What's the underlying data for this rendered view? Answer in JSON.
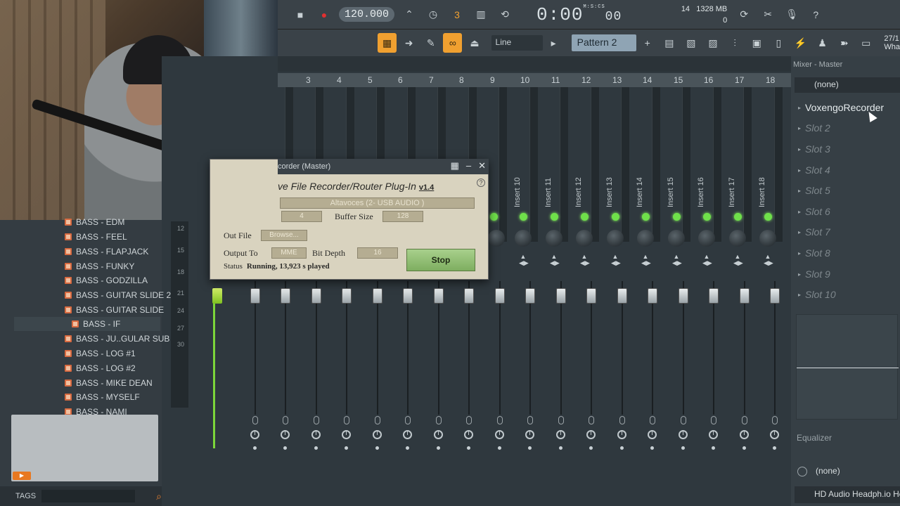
{
  "toolbar": {
    "tempo": "120.000",
    "time": "0:00",
    "time_frac": "00",
    "time_unit": "M:S:CS",
    "cpu_count": "14",
    "memory": "1328 MB",
    "poly": "0",
    "snap": "Line",
    "pattern": "Pattern 2",
    "what": "27/1",
    "what2": "Wha"
  },
  "mixer": {
    "title": "Mixer - Master",
    "numbers": [
      "3",
      "4",
      "5",
      "6",
      "7",
      "8",
      "9",
      "10",
      "11",
      "12",
      "13",
      "14",
      "15",
      "16",
      "17",
      "18"
    ],
    "inserts": [
      "Insert 10",
      "Insert 11",
      "Insert 12",
      "Insert 13",
      "Insert 14",
      "Insert 15",
      "Insert 16",
      "Insert 17",
      "Insert 18"
    ],
    "db_labels": [
      "12",
      "15",
      "18",
      "21",
      "24",
      "27",
      "30"
    ]
  },
  "browser": {
    "items": [
      "BASS - EDM",
      "BASS - FEEL",
      "BASS - FLAPJACK",
      "BASS - FUNKY",
      "BASS - GODZILLA",
      "BASS - GUITAR SLIDE 2",
      "BASS - GUITAR SLIDE",
      "BASS - IF",
      "BASS - JU..GULAR SUB",
      "BASS - LOG #1",
      "BASS - LOG #2",
      "BASS - MIKE DEAN",
      "BASS - MYSELF",
      "BASS - NAMI"
    ],
    "tags_label": "TAGS"
  },
  "right_panel": {
    "input": "(none)",
    "slots": [
      "VoxengoRecorder",
      "Slot 2",
      "Slot 3",
      "Slot 4",
      "Slot 5",
      "Slot 6",
      "Slot 7",
      "Slot 8",
      "Slot 9",
      "Slot 10"
    ],
    "eq_label": "Equalizer",
    "output": "(none)",
    "device": "HD Audio Headph.io He"
  },
  "plugin": {
    "title": "corder (Master)",
    "heading": "ve File Recorder/Router Plug-In",
    "version": "v1.4",
    "help": "?",
    "device": "Altavoces (2- USB AUDIO )",
    "channels": "4",
    "buffer_label": "Buffer Size",
    "buffer_value": "128",
    "out_file_label": "Out File",
    "browse": "Browse...",
    "output_to_label": "Output To",
    "output_to_value": "MME",
    "bit_depth_label": "Bit Depth",
    "bit_depth_value": "16",
    "status_label": "Status",
    "status_value": "Running, 13,923 s played",
    "stop": "Stop"
  }
}
